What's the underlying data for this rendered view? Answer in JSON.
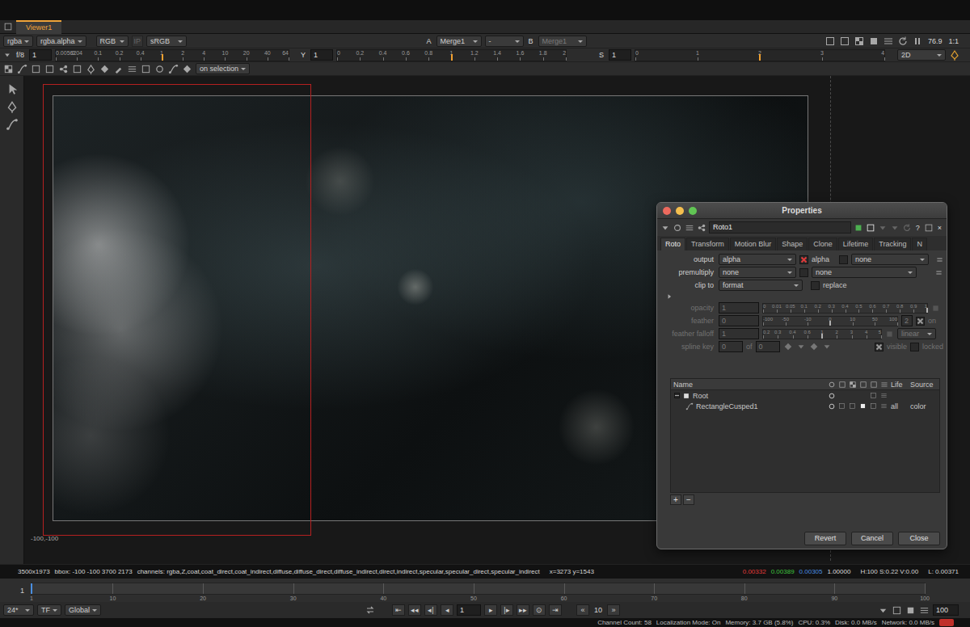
{
  "viewer_tab": {
    "label": "Viewer1",
    "selected": true
  },
  "viewer_bar": {
    "channels": "rgba",
    "display_channel": "rgba.alpha",
    "rgb_mode": "RGB",
    "ip": "IP",
    "lut": "sRGB",
    "a_label": "A",
    "a_input": "Merge1",
    "wipe_mode": "-",
    "b_label": "B",
    "b_input": "Merge1",
    "b_input_disabled": true,
    "zoom": "76.9",
    "proxy": "1:1"
  },
  "exposure_bar": {
    "fstop": "f/8",
    "gain": {
      "value": "1",
      "ticks": [
        "0.00562",
        "0.04",
        "0.1",
        "0.2",
        "0.4",
        "1",
        "2",
        "4",
        "10",
        "20",
        "40",
        "64"
      ],
      "level": 0.46
    },
    "gamma": {
      "label": "Y",
      "value": "1",
      "ticks": [
        "0",
        "0.2",
        "0.4",
        "0.6",
        "0.8",
        "1",
        "1.2",
        "1.4",
        "1.6",
        "1.8",
        "2"
      ],
      "level": 0.5
    },
    "saturation": {
      "label": "S",
      "value": "1",
      "ticks": [
        "0",
        "1",
        "2",
        "3",
        "4"
      ],
      "level": 0.5
    },
    "view_mode": "2D"
  },
  "roto_toolbar": {
    "mode": "on selection"
  },
  "viewer": {
    "origin_label": "-100,-100"
  },
  "properties": {
    "title": "Properties",
    "node_name": "Roto1",
    "help": "?",
    "close": "×",
    "tabs": [
      {
        "label": "Roto",
        "selected": true
      },
      {
        "label": "Transform",
        "selected": false
      },
      {
        "label": "Motion Blur",
        "selected": false
      },
      {
        "label": "Shape",
        "selected": false
      },
      {
        "label": "Clone",
        "selected": false
      },
      {
        "label": "Lifetime",
        "selected": false
      },
      {
        "label": "Tracking",
        "selected": false
      },
      {
        "label": "N",
        "selected": false
      }
    ],
    "knobs": [
      {
        "kind": "channels",
        "label": "output",
        "value": "alpha",
        "check": {
          "label": "alpha",
          "checked": true
        },
        "check2": {
          "checked": false
        },
        "value2": "none",
        "disabled": false
      },
      {
        "kind": "channels",
        "label": "premultiply",
        "value": "none",
        "check2": {
          "checked": false
        },
        "value2": "none",
        "disabled": false
      },
      {
        "kind": "choice",
        "label": "clip to",
        "value": "format",
        "check": {
          "label": "replace",
          "checked": false
        },
        "disabled": false
      },
      {
        "kind": "group",
        "expanded": false
      },
      {
        "kind": "slider",
        "label": "opacity",
        "value": "1",
        "ticks": [
          "0",
          "0.01",
          "0.05",
          "0.1",
          "0.2",
          "0.3",
          "0.4",
          "0.5",
          "0.6",
          "0.7",
          "0.8",
          "0.9",
          "1"
        ],
        "level": 1,
        "disabled": true
      },
      {
        "kind": "slider",
        "label": "feather",
        "value": "0",
        "ticks": [
          "-100",
          "-50",
          "-10",
          "0",
          "10",
          "50",
          "100"
        ],
        "level": 0.5,
        "disabled": true,
        "extra": "2",
        "check": {
          "label": "on",
          "checked": true
        }
      },
      {
        "kind": "slider",
        "label": "feather falloff",
        "value": "1",
        "ticks": [
          "0.2",
          "0.3",
          "0.4",
          "0.6",
          "1",
          "2",
          "3",
          "4",
          "5"
        ],
        "level": 0.5,
        "disabled": true,
        "choice": "linear"
      },
      {
        "kind": "splinekey",
        "label": "spline key",
        "value": "0",
        "of": "of",
        "total": "0",
        "disabled": true,
        "checks": [
          {
            "label": "visible",
            "checked": true
          },
          {
            "label": "locked",
            "checked": false
          }
        ]
      }
    ],
    "layers": {
      "columns": {
        "name": "Name",
        "life": "Life",
        "source": "Source"
      },
      "rows": [
        {
          "name": "Root",
          "depth": 0,
          "expanded": true,
          "visible": true,
          "life": "",
          "source": ""
        },
        {
          "name": "RectangleCusped1",
          "depth": 1,
          "visible": true,
          "life": "all",
          "source": "color"
        }
      ]
    },
    "list_buttons": [
      "+",
      "−"
    ],
    "buttons": [
      "Revert",
      "Cancel",
      "Close"
    ]
  },
  "info_bar": {
    "format": "3500x1973",
    "bbox": "bbox: -100 -100 3700 2173",
    "channels": "channels: rgba,Z,coat,coat_direct,coat_indirect,diffuse,diffuse_direct,diffuse_indirect,direct,indirect,specular,specular_direct,specular_indirect",
    "coords": "x=3273 y=1543",
    "pixel": [
      {
        "text": "0.00332",
        "color": "#e23b3b"
      },
      {
        "text": "0.00389",
        "color": "#3fc33f"
      },
      {
        "text": "0.00305",
        "color": "#4a8ee0"
      },
      {
        "text": "1.00000",
        "color": "#dddddd"
      }
    ],
    "hsv": "H:100 S:0.22 V:0.00",
    "luminance": "L: 0.00371"
  },
  "timeline": {
    "start": "1",
    "ticks": [
      "1",
      "10",
      "20",
      "30",
      "40",
      "50",
      "60",
      "70",
      "80",
      "90",
      "100"
    ],
    "current": "1"
  },
  "playback": {
    "fps": "24*",
    "time_format": "TF",
    "range": "Global",
    "back_buttons": [
      "⇤",
      "◂◂",
      "◂|",
      "◂"
    ],
    "frame": "1",
    "forward_buttons": [
      "▸",
      "|▸",
      "▸▸",
      "⊙",
      "⇥"
    ],
    "step_back": "«",
    "step": "10",
    "step_forward": "»",
    "end": "100"
  },
  "status_bar": {
    "items": [
      "Channel Count: 58",
      "Localization Mode: On",
      "Memory: 3.7 GB (5.8%)",
      "CPU: 0.3%",
      "Disk: 0.0 MB/s",
      "Network: 0.0 MB/s"
    ]
  }
}
